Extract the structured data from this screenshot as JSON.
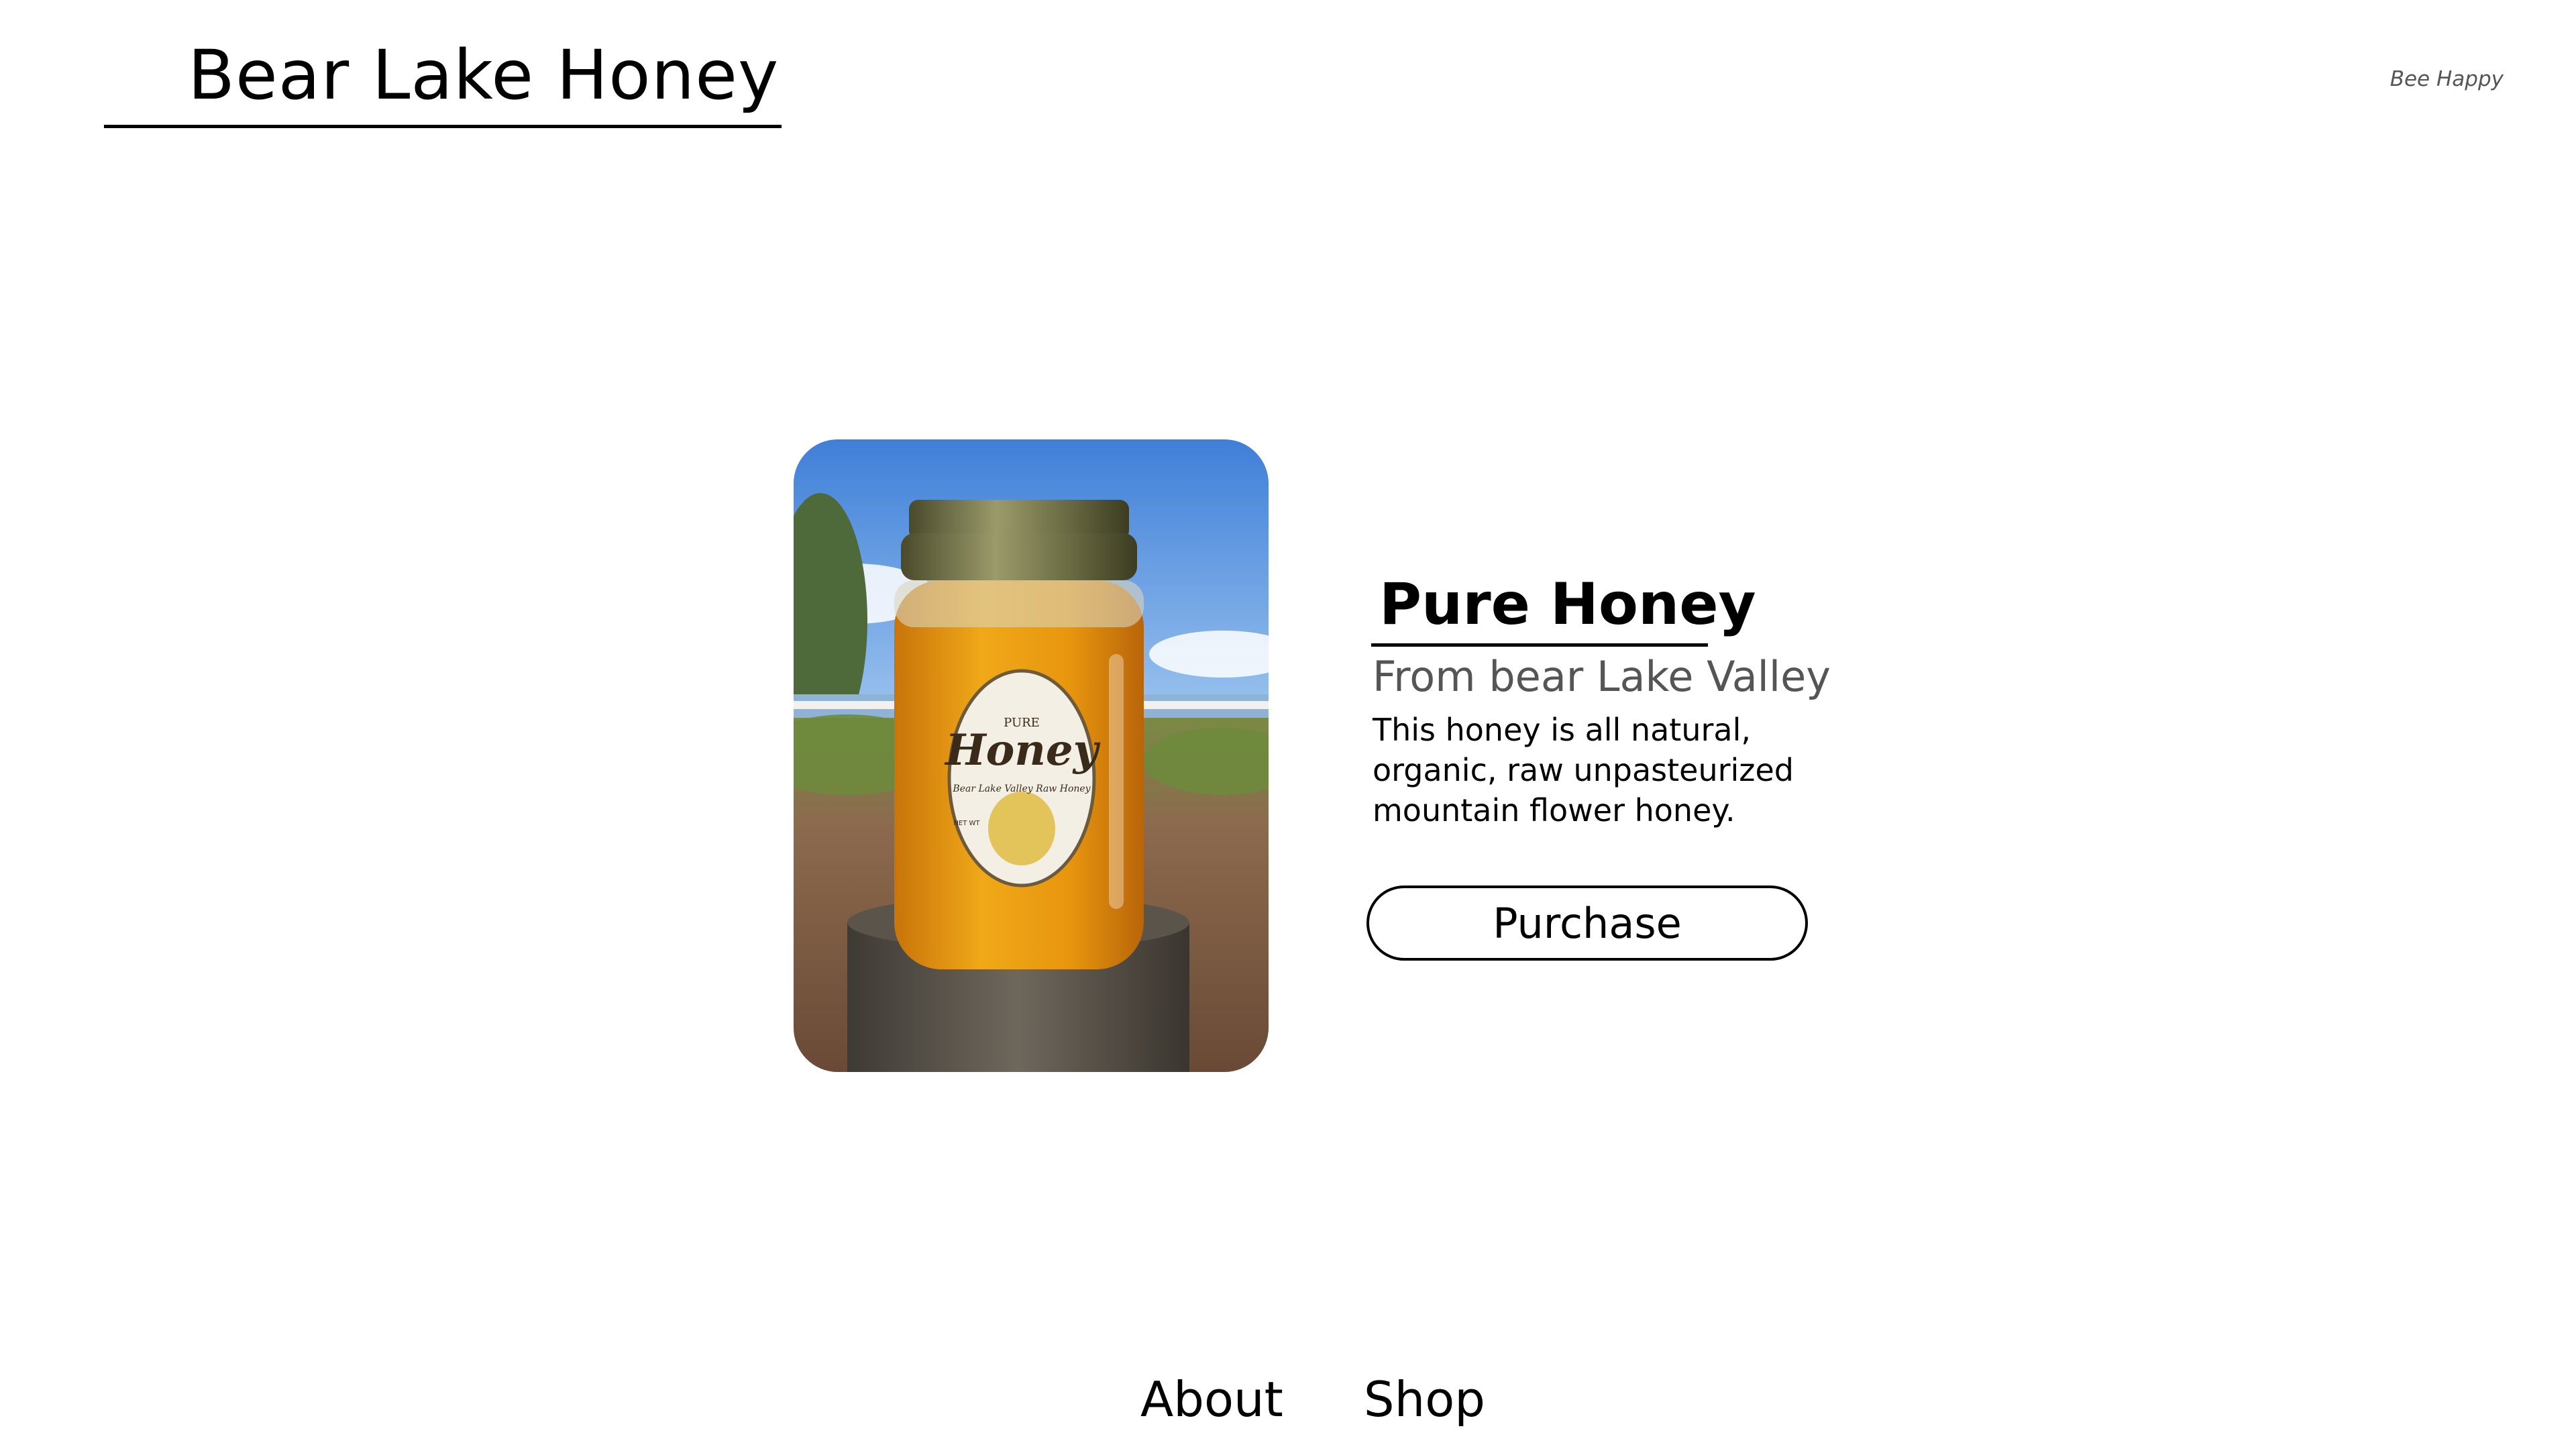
{
  "header": {
    "site_title": "Bear Lake Honey",
    "tagline": "Bee Happy"
  },
  "product": {
    "name": "Pure Honey",
    "origin": "From bear Lake Valley",
    "description": "This honey is all natural, organic, raw unpasteurized mountain flower honey.",
    "purchase_label": "Purchase",
    "image_alt": "Jar of pure honey on a wooden post",
    "label": {
      "top": "PURE",
      "main": "Honey",
      "script": "Bear Lake Valley Raw Honey",
      "net": "NET WT"
    }
  },
  "nav": {
    "items": [
      {
        "label": "About"
      },
      {
        "label": "Shop"
      }
    ]
  },
  "colors": {
    "text": "#000000",
    "muted": "#555555",
    "honey": "#e89a12",
    "sky": "#6fa3e6"
  }
}
